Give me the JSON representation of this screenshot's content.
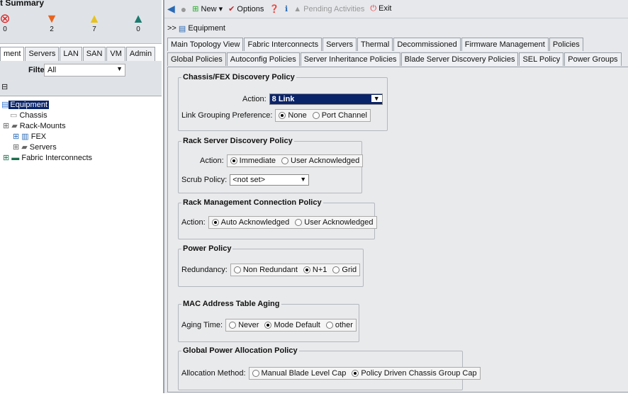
{
  "summary": {
    "title": "t Summary",
    "faults": [
      {
        "icon": "critical-icon",
        "count": "0"
      },
      {
        "icon": "major-icon",
        "count": "2"
      },
      {
        "icon": "minor-icon",
        "count": "7"
      },
      {
        "icon": "warning-icon",
        "count": "0"
      }
    ]
  },
  "nav_tabs": [
    "ment",
    "Servers",
    "LAN",
    "SAN",
    "VM",
    "Admin"
  ],
  "filter": {
    "label": "Filter:",
    "value": "All"
  },
  "tree": [
    {
      "label": "Equipment"
    },
    {
      "label": "Chassis"
    },
    {
      "label": "Rack-Mounts"
    },
    {
      "label": "FEX"
    },
    {
      "label": "Servers"
    },
    {
      "label": "Fabric Interconnects"
    }
  ],
  "toolbar": {
    "new": "New",
    "options": "Options",
    "pending": "Pending Activities",
    "exit": "Exit"
  },
  "breadcrumb": {
    "prefix": ">>",
    "label": "Equipment"
  },
  "main_tabs": [
    "Main Topology View",
    "Fabric Interconnects",
    "Servers",
    "Thermal",
    "Decommissioned",
    "Firmware Management",
    "Policies"
  ],
  "sub_tabs": [
    "Global Policies",
    "Autoconfig Policies",
    "Server Inheritance Policies",
    "Blade Server Discovery Policies",
    "SEL Policy",
    "Power Groups"
  ],
  "policies": {
    "chassis": {
      "title": "Chassis/FEX Discovery Policy",
      "action_label": "Action:",
      "action_value": "8 Link",
      "link_label": "Link Grouping Preference:",
      "opts": [
        "None",
        "Port Channel"
      ]
    },
    "rack": {
      "title": "Rack Server Discovery Policy",
      "action_label": "Action:",
      "opts": [
        "Immediate",
        "User Acknowledged"
      ],
      "scrub_label": "Scrub Policy:",
      "scrub_value": "<not set>"
    },
    "rackmgmt": {
      "title": "Rack Management Connection Policy",
      "action_label": "Action:",
      "opts": [
        "Auto Acknowledged",
        "User Acknowledged"
      ]
    },
    "power": {
      "title": "Power Policy",
      "label": "Redundancy:",
      "opts": [
        "Non Redundant",
        "N+1",
        "Grid"
      ]
    },
    "mac": {
      "title": "MAC Address Table Aging",
      "label": "Aging Time:",
      "opts": [
        "Never",
        "Mode Default",
        "other"
      ]
    },
    "alloc": {
      "title": "Global Power Allocation Policy",
      "label": "Allocation Method:",
      "opts": [
        "Manual Blade Level Cap",
        "Policy Driven Chassis Group Cap"
      ]
    }
  }
}
